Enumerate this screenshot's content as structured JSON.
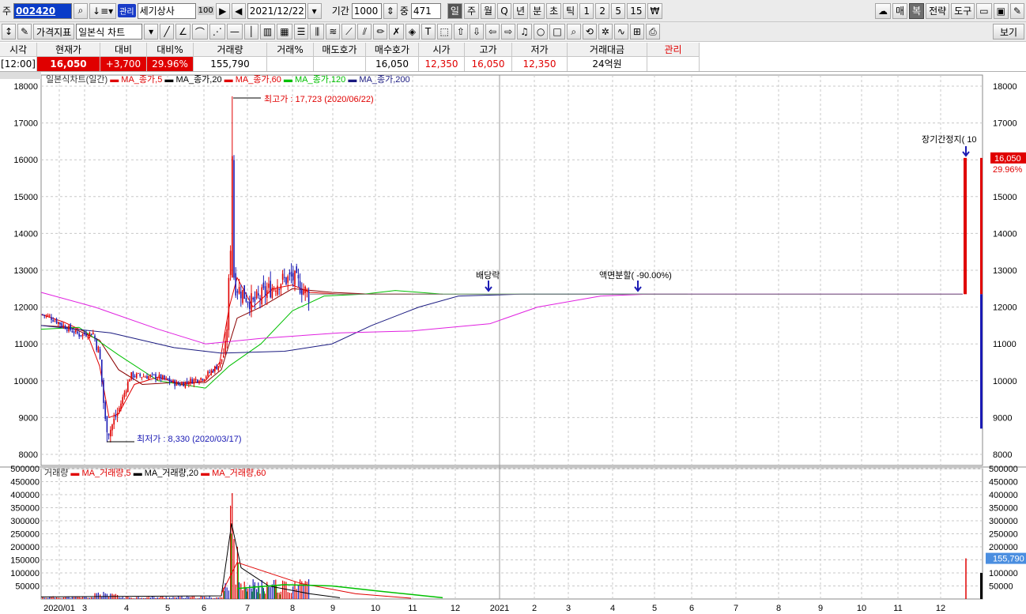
{
  "toolbar1": {
    "type_label": "주",
    "code": "002420",
    "name_badge": "관리",
    "name": "세기상사",
    "name_count": "100",
    "date": "2021/12/22",
    "period_label": "기간",
    "period_value": "1000",
    "zoom_label": "중",
    "zoom_value": "471",
    "periods": [
      "일",
      "주",
      "월",
      "Q",
      "년",
      "분",
      "초",
      "틱",
      "1",
      "2",
      "5",
      "15",
      "₩"
    ],
    "right": [
      "매",
      "복",
      "전략",
      "도구"
    ]
  },
  "toolbar2": {
    "price_index": "가격지표",
    "chart_type": "일본식 차트",
    "view": "보기"
  },
  "quote": {
    "headers": [
      "시각",
      "현재가",
      "대비",
      "대비%",
      "거래량",
      "거래%",
      "매도호가",
      "매수호가",
      "시가",
      "고가",
      "저가",
      "거래대금",
      "관리"
    ],
    "values": [
      "[12:00]",
      "16,050",
      "+3,700",
      "29.96%",
      "155,790",
      "",
      "",
      "16,050",
      "12,350",
      "16,050",
      "12,350",
      "24억원",
      ""
    ]
  },
  "legend_price": {
    "title": "일본식차트(일간)",
    "items": [
      {
        "label": "MA_종가,5",
        "color": "#e00000"
      },
      {
        "label": "MA_종가,20",
        "color": "#000000"
      },
      {
        "label": "MA_종가,60",
        "color": "#e00000"
      },
      {
        "label": "MA_종가,120",
        "color": "#00c000"
      },
      {
        "label": "MA_종가,200",
        "color": "#1a1a80"
      }
    ]
  },
  "legend_volume": {
    "title": "거래량",
    "items": [
      {
        "label": "MA_거래량,5",
        "color": "#e00000"
      },
      {
        "label": "MA_거래량,20",
        "color": "#000000"
      },
      {
        "label": "MA_거래량,60",
        "color": "#e00000"
      }
    ]
  },
  "annotations": {
    "high": "최고가 : 17,723 (2020/06/22)",
    "low": "최저가 : 8,330 (2020/03/17)",
    "dividend": "배당락",
    "split": "액면분할( -90.00%)",
    "halt": "장기간정지( 10",
    "current_price": "16,050",
    "current_pct": "29.96%",
    "current_volume": "155,790"
  },
  "colors": {
    "up": "#e00000",
    "down": "#1a1ab4",
    "accent": "#e00000",
    "ma200": "#e020e0",
    "ma120": "#1a1a80",
    "ma60": "#00c000"
  },
  "chart_data": [
    {
      "type": "candlestick",
      "ylim": [
        7700,
        18300
      ],
      "y_ticks": [
        8000,
        9000,
        10000,
        11000,
        12000,
        13000,
        14000,
        15000,
        16000,
        17000,
        18000
      ],
      "x_ticks": [
        "2020/01",
        "3",
        "4",
        "5",
        "6",
        "7",
        "8",
        "9",
        "10",
        "11",
        "12",
        "2021",
        "2",
        "3",
        "4",
        "5",
        "6",
        "7",
        "8",
        "9",
        "10",
        "11",
        "12"
      ],
      "close_series_approx": [
        {
          "date": "2020/01",
          "value": 11700
        },
        {
          "date": "2020/02",
          "value": 11300
        },
        {
          "date": "2020/03/17",
          "value": 8330
        },
        {
          "date": "2020/04",
          "value": 10100
        },
        {
          "date": "2020/05",
          "value": 9900
        },
        {
          "date": "2020/06/22",
          "value": 17723
        },
        {
          "date": "2020/07",
          "value": 12000
        },
        {
          "date": "2020/08",
          "value": 12700
        },
        {
          "date": "2020/09",
          "value": 12350
        },
        {
          "date": "2021/12/21",
          "value": 12350
        },
        {
          "date": "2021/12/22",
          "value": 16050
        }
      ],
      "high": {
        "value": 17723,
        "date": "2020/06/22"
      },
      "low": {
        "value": 8330,
        "date": "2020/03/17"
      }
    },
    {
      "type": "bar",
      "name": "거래량",
      "ylim": [
        0,
        500000
      ],
      "y_ticks": [
        50000,
        100000,
        150000,
        200000,
        250000,
        300000,
        350000,
        400000,
        450000,
        500000
      ],
      "last": 155790
    }
  ]
}
